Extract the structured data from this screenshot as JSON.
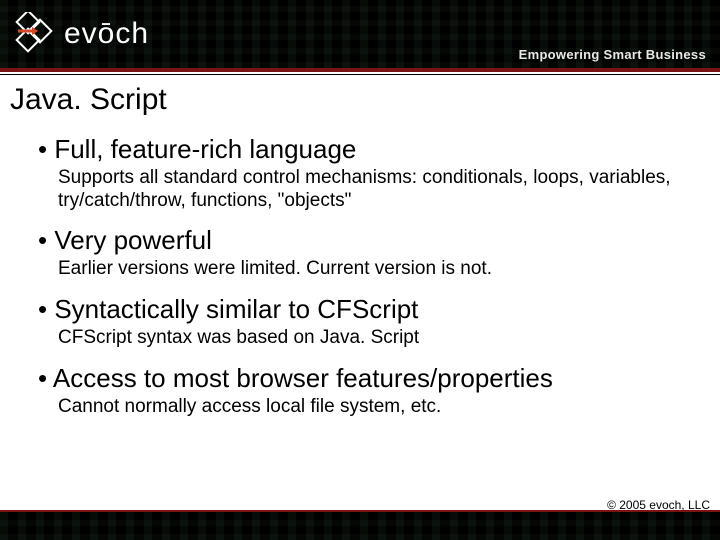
{
  "header": {
    "logo_text": "evōch",
    "tagline": "Empowering Smart Business"
  },
  "slide": {
    "title": "Java. Script",
    "bullets": [
      {
        "head": "• Full, feature-rich language",
        "sub": "Supports all standard control mechanisms: conditionals, loops, variables, try/catch/throw, functions, \"objects\""
      },
      {
        "head": "• Very powerful",
        "sub": "Earlier versions were limited. Current version is not."
      },
      {
        "head": "• Syntactically similar to CFScript",
        "sub": "CFScript syntax was based on Java. Script"
      },
      {
        "head": "• Access to most browser features/properties",
        "sub": "Cannot normally access local file system, etc."
      }
    ]
  },
  "footer": {
    "copyright": "© 2005 evoch, LLC"
  }
}
